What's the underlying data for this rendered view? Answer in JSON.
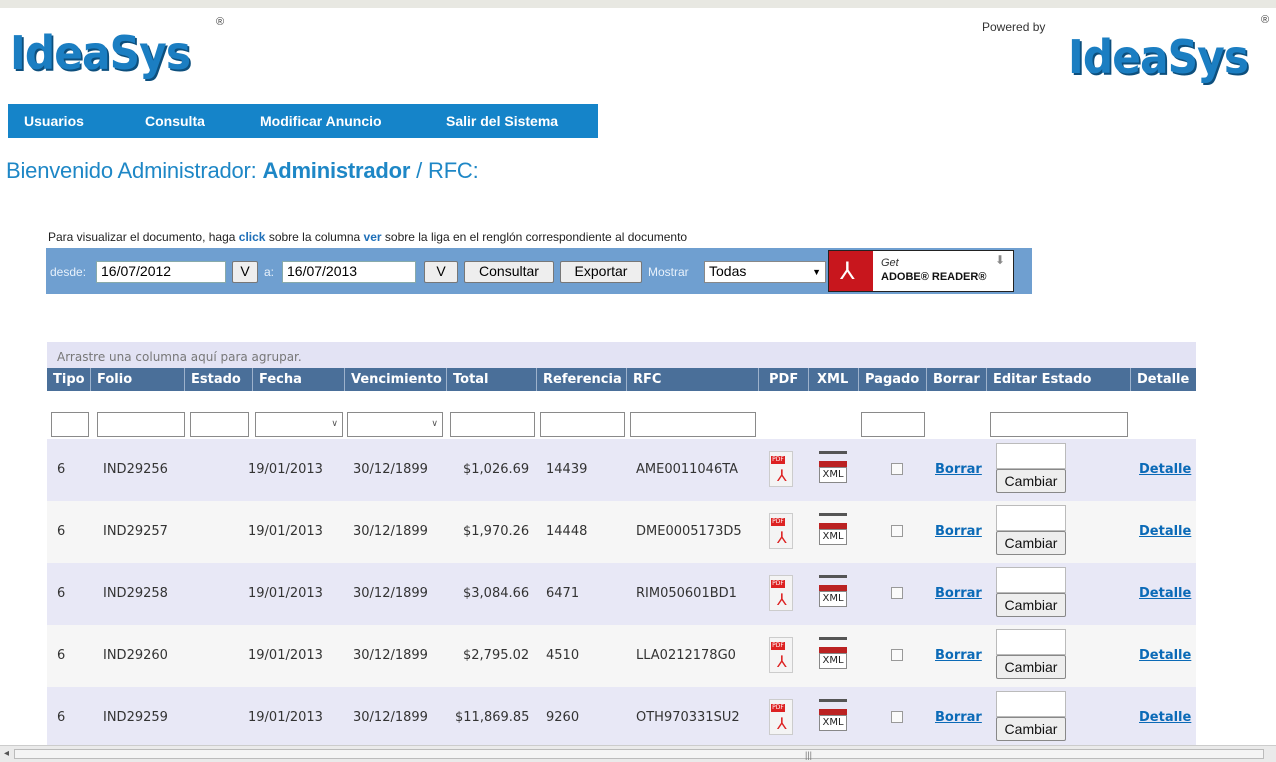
{
  "header": {
    "logo_text": "IdeaSys",
    "registered": "®",
    "powered_by": "Powered by"
  },
  "nav": [
    "Usuarios",
    "Consulta",
    "Modificar Anuncio",
    "Salir del Sistema"
  ],
  "welcome": {
    "prefix": "Bienvenido Administrador: ",
    "name": "Administrador",
    "suffix": " / RFC:"
  },
  "instructions": {
    "part1": "Para visualizar el documento, haga ",
    "click": "click",
    "part2": " sobre la columna ",
    "ver": "ver",
    "part3": " sobre la liga en el renglón correspondiente al documento"
  },
  "filter": {
    "desde_label": "desde:",
    "desde_value": "16/07/2012",
    "v_label": "V",
    "a_label": "a:",
    "a_value": "16/07/2013",
    "consultar": "Consultar",
    "exportar": "Exportar",
    "mostrar_label": "Mostrar",
    "mostrar_value": "Todas",
    "adobe_get": "Get",
    "adobe_reader": "ADOBE® READER®"
  },
  "grid": {
    "group_hint": "Arrastre una columna aquí para agrupar.",
    "columns": [
      "Tipo",
      "Folio",
      "Estado",
      "Fecha",
      "Vencimiento",
      "Total",
      "Referencia",
      "RFC",
      "PDF",
      "XML",
      "Pagado",
      "Borrar",
      "Editar Estado",
      "Detalle"
    ],
    "rows": [
      {
        "tipo": "6",
        "folio": "IND29256",
        "fecha": "19/01/2013",
        "vencimiento": "30/12/1899",
        "total": "$1,026.69",
        "referencia": "14439",
        "rfc": "AME0011046TA"
      },
      {
        "tipo": "6",
        "folio": "IND29257",
        "fecha": "19/01/2013",
        "vencimiento": "30/12/1899",
        "total": "$1,970.26",
        "referencia": "14448",
        "rfc": "DME0005173D5"
      },
      {
        "tipo": "6",
        "folio": "IND29258",
        "fecha": "19/01/2013",
        "vencimiento": "30/12/1899",
        "total": "$3,084.66",
        "referencia": "6471",
        "rfc": "RIM050601BD1"
      },
      {
        "tipo": "6",
        "folio": "IND29260",
        "fecha": "19/01/2013",
        "vencimiento": "30/12/1899",
        "total": "$2,795.02",
        "referencia": "4510",
        "rfc": "LLA0212178G0"
      },
      {
        "tipo": "6",
        "folio": "IND29259",
        "fecha": "19/01/2013",
        "vencimiento": "30/12/1899",
        "total": "$11,869.85",
        "referencia": "9260",
        "rfc": "OTH970331SU2"
      }
    ],
    "borrar_label": "Borrar",
    "cambiar_label": "Cambiar",
    "detalle_label": "Detalle",
    "pdf_label": "PDF",
    "xml_label": "XML"
  },
  "colors": {
    "nav_bg": "#1584c9",
    "header_bg": "#4a6f99",
    "filter_bg": "#6f9fd0",
    "link": "#0b6ab7"
  }
}
